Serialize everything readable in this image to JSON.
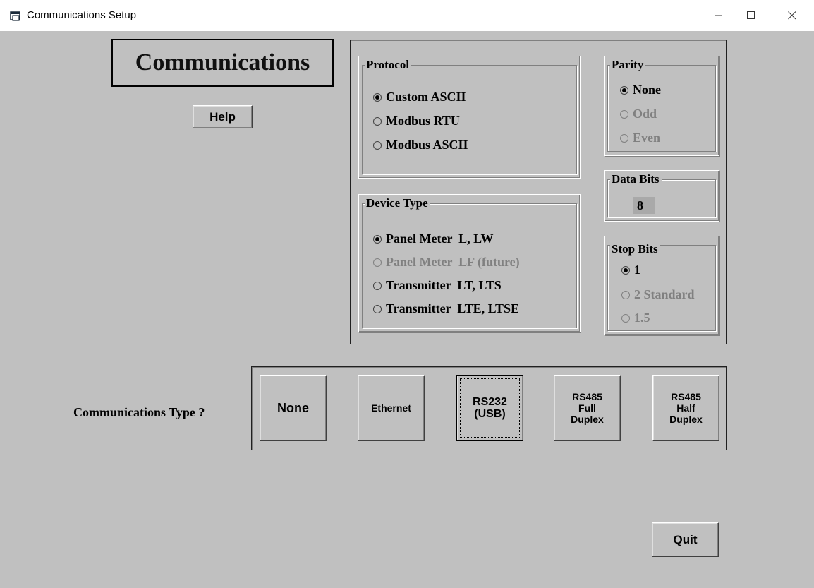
{
  "window": {
    "title": "Communications Setup",
    "icon": "app-window-icon",
    "controls": {
      "minimize": "minimize-icon",
      "maximize": "maximize-icon",
      "close": "close-icon"
    }
  },
  "header": {
    "title": "Communications",
    "help_label": "Help"
  },
  "protocol": {
    "legend": "Protocol",
    "options": [
      {
        "label": "Custom ASCII",
        "selected": true,
        "enabled": true
      },
      {
        "label": "Modbus RTU",
        "selected": false,
        "enabled": true
      },
      {
        "label": "Modbus ASCII",
        "selected": false,
        "enabled": true
      }
    ]
  },
  "device_type": {
    "legend": "Device Type",
    "options": [
      {
        "label": "Panel Meter  L, LW",
        "selected": true,
        "enabled": true
      },
      {
        "label": "Panel Meter  LF (future)",
        "selected": false,
        "enabled": false
      },
      {
        "label": "Transmitter  LT, LTS",
        "selected": false,
        "enabled": true
      },
      {
        "label": "Transmitter  LTE, LTSE",
        "selected": false,
        "enabled": true
      }
    ]
  },
  "parity": {
    "legend": "Parity",
    "options": [
      {
        "label": "None",
        "selected": true,
        "enabled": true
      },
      {
        "label": "Odd",
        "selected": false,
        "enabled": false
      },
      {
        "label": "Even",
        "selected": false,
        "enabled": false
      }
    ]
  },
  "data_bits": {
    "legend": "Data Bits",
    "value": "8"
  },
  "stop_bits": {
    "legend": "Stop Bits",
    "options": [
      {
        "label": "1",
        "selected": true,
        "enabled": true
      },
      {
        "label": "2 Standard",
        "selected": false,
        "enabled": false
      },
      {
        "label": "1.5",
        "selected": false,
        "enabled": false
      }
    ]
  },
  "comm_type": {
    "label": "Communications Type ?",
    "buttons": [
      {
        "label": "None"
      },
      {
        "label": "Ethernet"
      },
      {
        "label": "RS232\n(USB)",
        "focused": true
      },
      {
        "label": "RS485\nFull\nDuplex"
      },
      {
        "label": "RS485\nHalf\nDuplex"
      }
    ]
  },
  "footer": {
    "quit_label": "Quit"
  },
  "colors": {
    "background": "#c0c0c0",
    "disabled_text": "#808080",
    "data_bits_field": "#a9a9a9"
  }
}
